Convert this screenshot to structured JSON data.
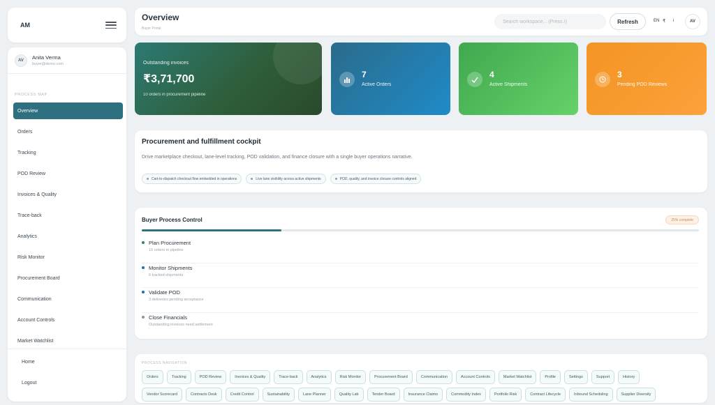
{
  "brand": {
    "logo": "AM"
  },
  "user": {
    "initials": "AV",
    "name": "Anita Verma",
    "email": "buyer@demo.com"
  },
  "sidebar": {
    "section_title": "PROCESS MAP",
    "items": [
      {
        "label": "Overview",
        "active": true
      },
      {
        "label": "Orders"
      },
      {
        "label": "Tracking"
      },
      {
        "label": "POD Review"
      },
      {
        "label": "Invoices & Quality"
      },
      {
        "label": "Trace-back"
      },
      {
        "label": "Analytics"
      },
      {
        "label": "Risk Monitor"
      },
      {
        "label": "Procurement Board"
      },
      {
        "label": "Communication"
      },
      {
        "label": "Account Controls"
      },
      {
        "label": "Market Watchlist"
      }
    ],
    "footer": [
      {
        "label": "Home"
      },
      {
        "label": "Logout"
      }
    ]
  },
  "header": {
    "title": "Overview",
    "subtitle": "Buyer Portal",
    "search_placeholder": "Search workspace... (Press /)",
    "refresh_label": "Refresh",
    "lang": "EN",
    "currency": "₹",
    "info": "i",
    "avatar": "AV"
  },
  "kpis": {
    "outstanding": {
      "label": "Outstanding invoices",
      "value": "₹3,71,700",
      "note": "10 orders in procurement pipeline"
    },
    "orders": {
      "value": "7",
      "label": "Active Orders",
      "icon": "bar-chart-icon"
    },
    "shipments": {
      "value": "4",
      "label": "Active Shipments",
      "icon": "check-icon"
    },
    "pod": {
      "value": "3",
      "label": "Pending POD Reviews",
      "icon": "clock-icon"
    }
  },
  "cockpit": {
    "title": "Procurement and fulfillment cockpit",
    "description": "Drive marketplace checkout, lane-level tracking, POD validation, and finance closure with a single buyer operations narrative.",
    "chips": [
      "Cart-to-dispatch checkout flow embedded in operations",
      "Live lane visibility across active shipments",
      "POD, quality, and invoice closure controls aligned"
    ]
  },
  "process_control": {
    "title": "Buyer Process Control",
    "badge": "25% complete",
    "progress": 0.25,
    "steps": [
      {
        "title": "Plan Procurement",
        "sub": "10 orders in pipeline",
        "color": "#2e8b57"
      },
      {
        "title": "Monitor Shipments",
        "sub": "6 tracked shipments",
        "color": "#1f6fa8"
      },
      {
        "title": "Validate POD",
        "sub": "3 deliveries pending acceptance",
        "color": "#1f6fa8"
      },
      {
        "title": "Close Financials",
        "sub": "Outstanding invoices need settlement",
        "color": "#8a949b"
      }
    ]
  },
  "process_navigation": {
    "title": "PROCESS NAVIGATION",
    "row1": [
      "Orders",
      "Tracking",
      "POD Review",
      "Invoices & Quality",
      "Trace-back",
      "Analytics",
      "Risk Monitor",
      "Procurement Board",
      "Communication",
      "Account Controls",
      "Market Watchlist",
      "Profile",
      "Settings",
      "Support",
      "History"
    ],
    "row2": [
      "Vendor Scorecard",
      "Contracts Desk",
      "Credit Control",
      "Sustainability",
      "Lane Planner",
      "Quality Lab",
      "Tender Board",
      "Insurance Claims",
      "Commodity Index",
      "Portfolio Risk",
      "Contract Lifecycle",
      "Inbound Scheduling",
      "Supplier Diversity"
    ]
  }
}
